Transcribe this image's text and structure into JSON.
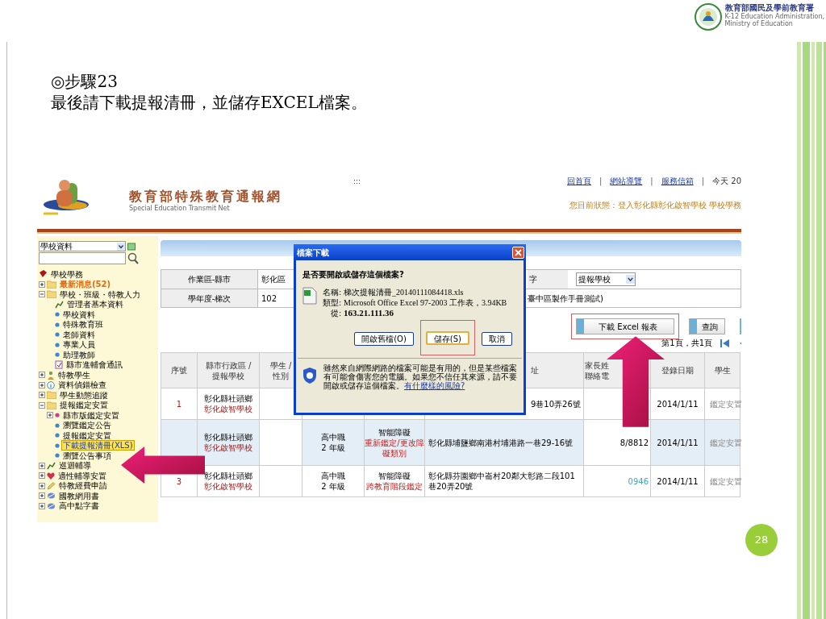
{
  "agency_logo": {
    "name": "教育部國民及學前教育署",
    "subtitle_lines": [
      "K-12 Education Administration,",
      "Ministry of Education"
    ]
  },
  "slide": {
    "step": "◎步驟23",
    "instruction": "最後請下載提報清冊，並儲存EXCEL檔案。",
    "page_number": "28"
  },
  "site": {
    "title": "教育部特殊教育通報網",
    "subtitle": "Special Education Transmit Net",
    "marker": ":::",
    "links": [
      "回首頁",
      "網站導覽",
      "服務信箱"
    ],
    "separator": "|",
    "date_text": "今天 20",
    "status": "您目前狀態：登入彰化縣彰化啟智學校 學校學務"
  },
  "sidebar": {
    "select": {
      "value": "學校資料"
    },
    "tree": [
      {
        "label": "學校學務",
        "kind": "book",
        "selected": false,
        "children": [
          {
            "label": "最新消息(52)",
            "kind": "folder",
            "emphasis": true,
            "expanded": false,
            "selected": false
          },
          {
            "label": "學校・班級・特教人力",
            "kind": "folder",
            "emphasis": false,
            "expanded": true,
            "selected": false,
            "children": [
              {
                "label": "管理者基本資料",
                "kind": "chart",
                "selected": false
              },
              {
                "label": "學校資料",
                "kind": "dot",
                "selected": false
              },
              {
                "label": "特殊教育班",
                "kind": "dot",
                "selected": false
              },
              {
                "label": "老師資料",
                "kind": "dot",
                "selected": false
              },
              {
                "label": "專業人員",
                "kind": "dot",
                "selected": false
              },
              {
                "label": "助理教師",
                "kind": "dot",
                "selected": false
              },
              {
                "label": "縣市進輔會通訊",
                "kind": "document",
                "selected": false
              }
            ]
          },
          {
            "label": "特教學生",
            "kind": "person",
            "expanded": false,
            "selected": false
          },
          {
            "label": "資料偵錯檢查",
            "kind": "info",
            "expanded": false,
            "selected": false
          },
          {
            "label": "學生動態追蹤",
            "kind": "folder",
            "expanded": false,
            "selected": false
          },
          {
            "label": "提報鑑定安置",
            "kind": "folder",
            "expanded": true,
            "selected": false,
            "children": [
              {
                "label": "縣市版鑑定安置",
                "kind": "star",
                "expanded": false,
                "selected": false
              },
              {
                "label": "瀏覽鑑定公告",
                "kind": "dot",
                "selected": false
              },
              {
                "label": "提報鑑定安置",
                "kind": "dot",
                "selected": false
              },
              {
                "label": "下載提報清冊(XLS)",
                "kind": "dot",
                "selected": true
              },
              {
                "label": "瀏覽公告事項",
                "kind": "dot",
                "selected": false
              }
            ]
          },
          {
            "label": "巡迴輔導",
            "kind": "chart",
            "expanded": false,
            "selected": false
          },
          {
            "label": "適性輔導安置",
            "kind": "heart",
            "expanded": false,
            "selected": false
          },
          {
            "label": "特教經費申請",
            "kind": "pencil",
            "expanded": false,
            "selected": false
          },
          {
            "label": "國教網用書",
            "kind": "globe",
            "expanded": false,
            "selected": false
          },
          {
            "label": "高中點字書",
            "kind": "globe",
            "expanded": false,
            "selected": false
          }
        ]
      }
    ]
  },
  "filters": [
    {
      "label": "作業區-縣市",
      "value": "彰化區",
      "label_2": "字",
      "select_value": "提報學校"
    },
    {
      "label": "學年度-梯次",
      "value": "102",
      "tail": "臺中區製作手冊測試)"
    }
  ],
  "buttons": [
    {
      "label": "下載 Excel 報表",
      "annotated": true
    },
    {
      "label": "查詢",
      "annotated": false
    },
    {
      "annotated": false
    }
  ],
  "pagination": {
    "text": "第1頁，共1頁"
  },
  "table": {
    "columns": [
      {
        "lines": [
          "序號"
        ]
      },
      {
        "lines": [
          "縣市行政區 /",
          "提報學校"
        ]
      },
      {
        "lines": [
          "學生 /",
          "性別"
        ]
      },
      {},
      {},
      {
        "lines": [
          "址"
        ]
      },
      {
        "lines": [
          "家長姓",
          "聯絡電"
        ]
      },
      {
        "lines": [
          "登錄日期"
        ]
      },
      {
        "lines": [
          "學生"
        ]
      }
    ],
    "rows": [
      {
        "selected": false,
        "number": "1",
        "district": "彰化縣社頭鄉",
        "school": "彰化啟智學校",
        "address": "9巷10弄26號",
        "date": "2014/1/11",
        "status": "鑑定安置"
      },
      {
        "selected": true,
        "district": "彰化縣社頭鄉",
        "school": "彰化啟智學校",
        "level": "高中職",
        "grade": "2 年級",
        "disability": "智能障礙",
        "case_type": "重新鑑定/更改障礙類別",
        "address": "彰化縣埔鹽鄉南港村埔港路一巷29-16號",
        "parent": "8/8812",
        "date": "2014/1/11",
        "status": "鑑定安置"
      },
      {
        "selected": false,
        "number": "3",
        "district": "彰化縣社頭鄉",
        "school": "彰化啟智學校",
        "level": "高中職",
        "grade": "2 年級",
        "disability": "智能障礙",
        "case_type": "跨教育階段鑑定",
        "address": "彰化縣芬園鄉中崙村20鄰大彰路二段101巷20弄20號",
        "parent": "0946",
        "date": "2014/1/11",
        "status": "鑑定安置"
      }
    ]
  },
  "dialog": {
    "title": "檔案下載",
    "question": "是否要開啟或儲存這個檔案?",
    "fields": [
      {
        "label": "名稱:",
        "value": "梯次提報清冊_20140111084418.xls",
        "strong": false
      },
      {
        "label": "類型:",
        "value": "Microsoft Office Excel 97-2003 工作表，3.94KB",
        "strong": false
      },
      {
        "label": "從:",
        "value": "163.21.111.36",
        "strong": true
      }
    ],
    "buttons": [
      {
        "label": "開啟舊檔(O)",
        "annotated": false
      },
      {
        "label": "儲存(S)",
        "annotated": true
      },
      {
        "label": "取消",
        "annotated": false
      }
    ],
    "warning": "雖然來自網際網路的檔案可能是有用的，但是某些檔案有可能會傷害您的電腦。如果您不信任其來源，請不要開啟或儲存這個檔案。",
    "warning_link": "有什麼樣的風險?"
  }
}
